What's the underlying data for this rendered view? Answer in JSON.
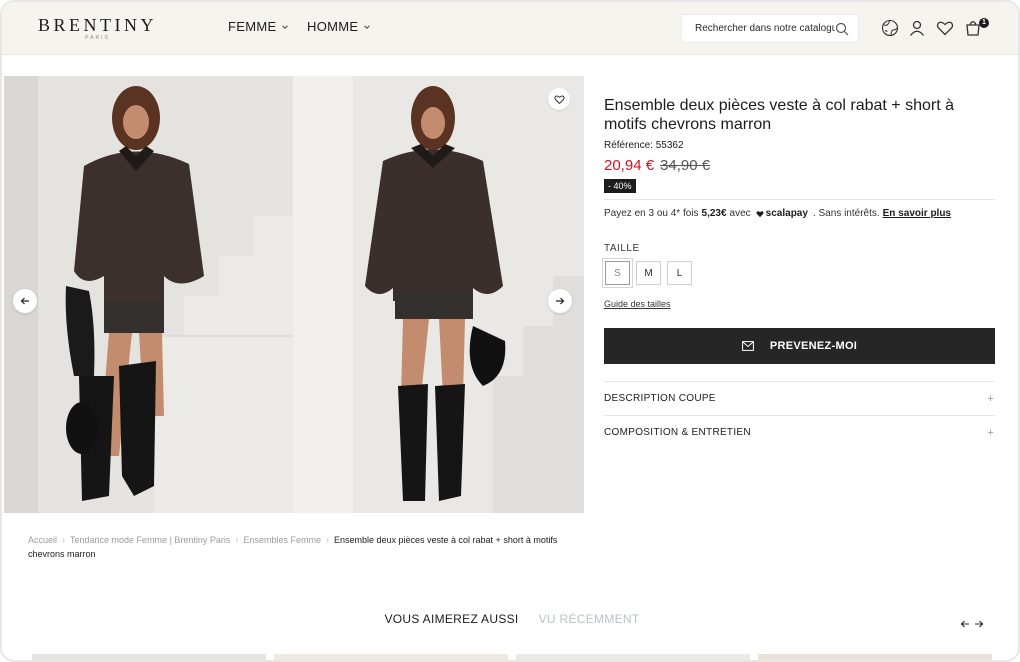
{
  "header": {
    "logo": "BRENTINY",
    "logo_sub": "PARIS",
    "nav": [
      {
        "label": "FEMME"
      },
      {
        "label": "HOMME"
      }
    ],
    "search_placeholder": "Rechercher dans notre catalogue",
    "cart_count": "1",
    "icons": [
      "globe-icon",
      "user-icon",
      "heart-icon",
      "cart-icon"
    ]
  },
  "product": {
    "title": "Ensemble deux pièces veste à col rabat + short à motifs chevrons marron",
    "reference": "Référence: 55362",
    "price": "20,94 €",
    "old_price": "34,90 €",
    "discount": "- 40%",
    "scalapay": {
      "prefix": "Payez en 3 ou 4* fois",
      "amount": "5,23€",
      "with": "avec",
      "brand": "scalapay",
      "suffix": ". Sans intérêts.",
      "link": "En savoir plus"
    },
    "size_label": "TAILLE",
    "sizes": [
      "S",
      "M",
      "L"
    ],
    "selected_size": "S",
    "size_guide": "Guide des tailles",
    "notify_button": "PREVENEZ-MOI",
    "accordions": [
      "DESCRIPTION COUPE",
      "COMPOSITION & ENTRETIEN"
    ]
  },
  "breadcrumb": {
    "items": [
      "Accueil",
      "Tendance mode Femme | Brentiny Paris",
      "Ensembles Femme"
    ],
    "current": "Ensemble deux pièces veste à col rabat + short à motifs chevrons marron"
  },
  "recommendations": {
    "tabs": [
      "VOUS AIMEREZ AUSSI",
      "VU RÉCEMMENT"
    ],
    "active_tab": "VOUS AIMEREZ AUSSI"
  },
  "colors": {
    "accent_price": "#d0101d",
    "header_bg": "#f6f4ef",
    "button_bg": "#262626"
  }
}
